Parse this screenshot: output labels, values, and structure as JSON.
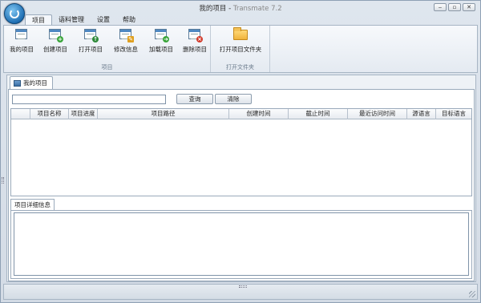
{
  "window": {
    "title": "我的项目",
    "app_name": "Transmate 7.2",
    "controls": [
      "minimize",
      "restore",
      "close"
    ]
  },
  "menu": {
    "tabs": [
      {
        "label": "项目",
        "active": true
      },
      {
        "label": "语料管理",
        "active": false
      },
      {
        "label": "设置",
        "active": false
      },
      {
        "label": "帮助",
        "active": false
      }
    ]
  },
  "ribbon": {
    "project_group": {
      "label": "项目",
      "buttons": [
        {
          "label": "我的项目",
          "icon": "my-projects-icon"
        },
        {
          "label": "创建项目",
          "icon": "create-project-icon"
        },
        {
          "label": "打开项目",
          "icon": "open-project-icon"
        },
        {
          "label": "修改信息",
          "icon": "edit-info-icon"
        },
        {
          "label": "加载项目",
          "icon": "load-project-icon"
        },
        {
          "label": "删除项目",
          "icon": "delete-project-icon"
        }
      ]
    },
    "folder_group": {
      "label": "打开文件夹",
      "buttons": [
        {
          "label": "打开项目文件夹",
          "icon": "folder-icon"
        }
      ]
    }
  },
  "panel": {
    "tab_label": "我的项目",
    "search": {
      "value": "",
      "placeholder": ""
    },
    "query_button": "查询",
    "clear_button": "清除",
    "table": {
      "columns": [
        "项目名称",
        "项目进度",
        "项目路径",
        "创建时间",
        "截止时间",
        "最近访问时间",
        "源语言",
        "目标语言"
      ],
      "rows": []
    },
    "detail_tab_label": "项目详细信息"
  },
  "colors": {
    "frame": "#dfe6ee",
    "accent": "#4f88c2",
    "border": "#9aaabb"
  }
}
